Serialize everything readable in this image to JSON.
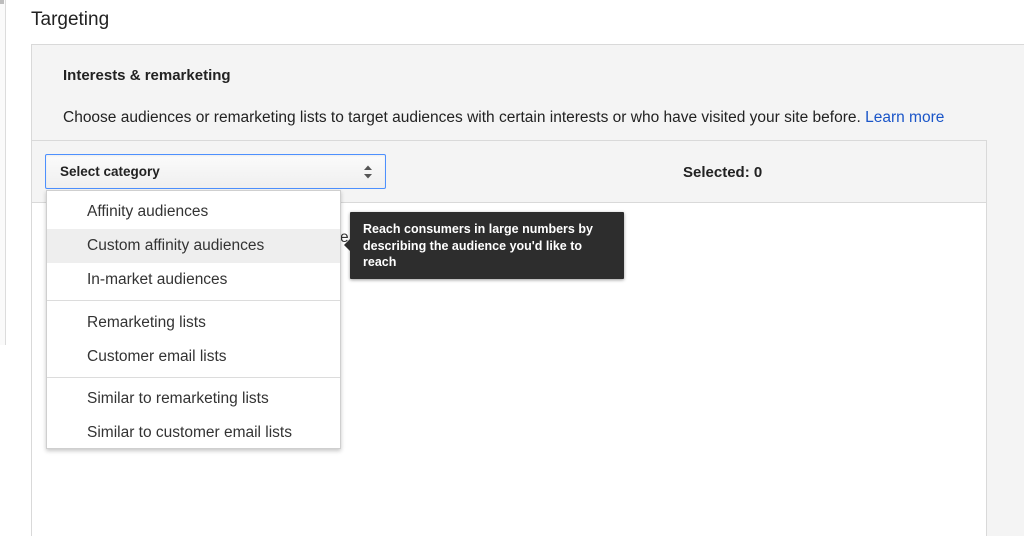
{
  "section": {
    "title": "Targeting"
  },
  "panel": {
    "title": "Interests & remarketing",
    "description": "Choose audiences or remarketing lists to target audiences with certain interests or who have visited your site before.",
    "learn_more": "Learn more"
  },
  "select": {
    "label": "Select category"
  },
  "selected": {
    "label": "Selected: 0"
  },
  "dropdown": {
    "items": [
      "Affinity audiences",
      "Custom affinity audiences",
      "In-market audiences",
      "Remarketing lists",
      "Customer email lists",
      "Similar to remarketing lists",
      "Similar to customer email lists"
    ],
    "hovered": "Custom affinity audiences"
  },
  "tooltip": {
    "text": "Reach consumers in large numbers by describing the audience you'd like to reach"
  },
  "peek": {
    "text": "e"
  },
  "colors": {
    "link": "#1a55c8",
    "focus_border": "#4d90fe",
    "tooltip_bg": "#2d2d2d",
    "panel_bg": "#f4f4f4"
  },
  "icons": {
    "select_arrows": "sort-arrows-icon"
  }
}
